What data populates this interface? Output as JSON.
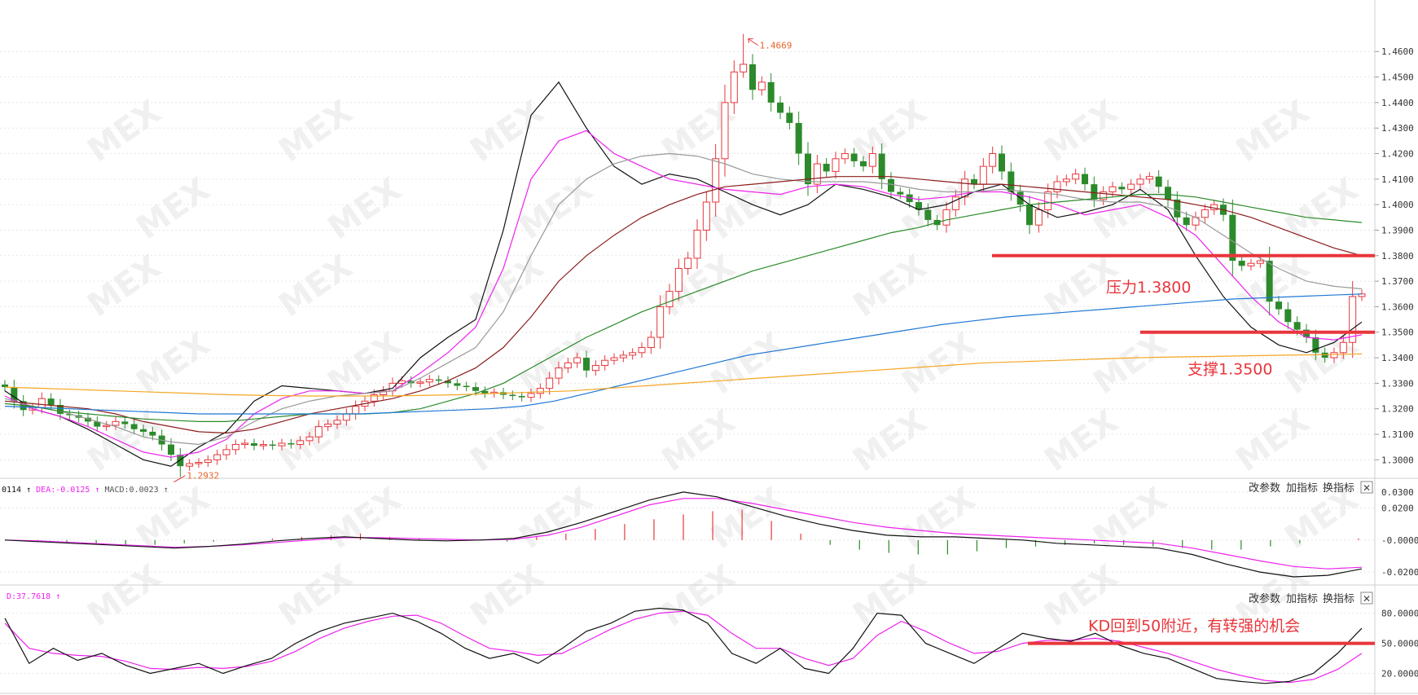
{
  "chart_data": {
    "type": "candlestick",
    "main": {
      "y_ticks": [
        "1.4600",
        "1.4500",
        "1.4400",
        "1.4300",
        "1.4200",
        "1.4100",
        "1.4000",
        "1.3900",
        "1.3800",
        "1.3700",
        "1.3600",
        "1.3500",
        "1.3400",
        "1.3300",
        "1.3200",
        "1.3100",
        "1.3000"
      ],
      "ylim": [
        1.295,
        1.477
      ],
      "high_label": "1.4669",
      "low_label": "1.2932",
      "closes": [
        1.3285,
        1.323,
        1.3195,
        1.3205,
        1.324,
        1.3215,
        1.318,
        1.3175,
        1.3165,
        1.315,
        1.313,
        1.3135,
        1.315,
        1.314,
        1.312,
        1.311,
        1.3095,
        1.306,
        1.302,
        1.2975,
        1.2985,
        1.299,
        1.3,
        1.302,
        1.304,
        1.306,
        1.3065,
        1.3055,
        1.306,
        1.3055,
        1.3065,
        1.306,
        1.3075,
        1.309,
        1.313,
        1.314,
        1.3155,
        1.318,
        1.321,
        1.323,
        1.3255,
        1.327,
        1.33,
        1.331,
        1.33,
        1.3305,
        1.3315,
        1.331,
        1.33,
        1.329,
        1.3285,
        1.327,
        1.326,
        1.3265,
        1.3255,
        1.325,
        1.3245,
        1.326,
        1.328,
        1.332,
        1.336,
        1.338,
        1.34,
        1.335,
        1.337,
        1.339,
        1.34,
        1.341,
        1.342,
        1.344,
        1.348,
        1.36,
        1.366,
        1.375,
        1.379,
        1.39,
        1.401,
        1.418,
        1.44,
        1.452,
        1.455,
        1.445,
        1.448,
        1.44,
        1.436,
        1.432,
        1.42,
        1.408,
        1.416,
        1.413,
        1.418,
        1.42,
        1.417,
        1.415,
        1.42,
        1.41,
        1.405,
        1.404,
        1.401,
        1.398,
        1.394,
        1.392,
        1.398,
        1.403,
        1.41,
        1.408,
        1.415,
        1.42,
        1.413,
        1.405,
        1.4,
        1.392,
        1.398,
        1.405,
        1.409,
        1.41,
        1.412,
        1.408,
        1.402,
        1.405,
        1.407,
        1.406,
        1.408,
        1.41,
        1.411,
        1.407,
        1.402,
        1.395,
        1.392,
        1.395,
        1.398,
        1.4,
        1.396,
        1.378,
        1.376,
        1.377,
        1.378,
        1.362,
        1.359,
        1.354,
        1.351,
        1.348,
        1.342,
        1.34,
        1.342,
        1.346,
        1.364,
        1.365
      ],
      "ma_series": [
        {
          "color": "#111111",
          "values": [
            1.327,
            1.32,
            1.317,
            1.312,
            1.306,
            1.3,
            1.2975,
            1.305,
            1.311,
            1.323,
            1.329,
            1.328,
            1.327,
            1.326,
            1.328,
            1.34,
            1.348,
            1.355,
            1.39,
            1.435,
            1.448,
            1.43,
            1.415,
            1.408,
            1.412,
            1.41,
            1.405,
            1.4,
            1.396,
            1.4,
            1.408,
            1.406,
            1.403,
            1.398,
            1.4,
            1.405,
            1.408,
            1.4,
            1.395,
            1.397,
            1.4,
            1.406,
            1.398,
            1.38,
            1.364,
            1.352,
            1.345,
            1.342,
            1.346,
            1.354
          ]
        },
        {
          "color": "#ee22ee",
          "values": [
            1.325,
            1.32,
            1.317,
            1.313,
            1.308,
            1.303,
            1.301,
            1.303,
            1.308,
            1.318,
            1.324,
            1.327,
            1.327,
            1.326,
            1.327,
            1.334,
            1.342,
            1.352,
            1.375,
            1.41,
            1.425,
            1.429,
            1.42,
            1.415,
            1.41,
            1.408,
            1.406,
            1.405,
            1.404,
            1.407,
            1.408,
            1.407,
            1.404,
            1.402,
            1.403,
            1.405,
            1.405,
            1.403,
            1.4,
            1.396,
            1.398,
            1.4,
            1.395,
            1.388,
            1.376,
            1.364,
            1.354,
            1.348,
            1.347,
            1.349
          ]
        },
        {
          "color": "#999999",
          "values": [
            1.324,
            1.321,
            1.319,
            1.316,
            1.313,
            1.309,
            1.307,
            1.306,
            1.309,
            1.315,
            1.32,
            1.323,
            1.325,
            1.326,
            1.327,
            1.332,
            1.338,
            1.344,
            1.358,
            1.38,
            1.4,
            1.41,
            1.416,
            1.419,
            1.42,
            1.419,
            1.416,
            1.412,
            1.41,
            1.409,
            1.409,
            1.409,
            1.408,
            1.406,
            1.405,
            1.405,
            1.406,
            1.405,
            1.404,
            1.402,
            1.401,
            1.401,
            1.399,
            1.395,
            1.388,
            1.381,
            1.375,
            1.37,
            1.368,
            1.367
          ]
        },
        {
          "color": "#8b1c1c",
          "values": [
            1.323,
            1.322,
            1.321,
            1.32,
            1.318,
            1.315,
            1.313,
            1.311,
            1.3105,
            1.312,
            1.315,
            1.318,
            1.32,
            1.322,
            1.324,
            1.327,
            1.331,
            1.336,
            1.344,
            1.356,
            1.37,
            1.38,
            1.388,
            1.395,
            1.4,
            1.404,
            1.407,
            1.408,
            1.409,
            1.41,
            1.411,
            1.411,
            1.411,
            1.41,
            1.409,
            1.408,
            1.408,
            1.407,
            1.406,
            1.405,
            1.404,
            1.403,
            1.402,
            1.4,
            1.398,
            1.395,
            1.391,
            1.387,
            1.383,
            1.38
          ]
        },
        {
          "color": "#2a8a2a",
          "values": [
            1.322,
            1.321,
            1.319,
            1.318,
            1.317,
            1.316,
            1.3155,
            1.315,
            1.315,
            1.316,
            1.317,
            1.318,
            1.318,
            1.318,
            1.3185,
            1.32,
            1.323,
            1.326,
            1.33,
            1.336,
            1.342,
            1.348,
            1.353,
            1.358,
            1.362,
            1.366,
            1.37,
            1.374,
            1.377,
            1.38,
            1.383,
            1.386,
            1.389,
            1.391,
            1.394,
            1.396,
            1.398,
            1.4,
            1.401,
            1.402,
            1.403,
            1.404,
            1.404,
            1.403,
            1.401,
            1.399,
            1.397,
            1.395,
            1.394,
            1.393
          ]
        },
        {
          "color": "#1f77d4",
          "values": [
            1.321,
            1.3205,
            1.32,
            1.3195,
            1.319,
            1.3185,
            1.318,
            1.318,
            1.318,
            1.318,
            1.318,
            1.318,
            1.3185,
            1.319,
            1.3195,
            1.32,
            1.321,
            1.323,
            1.326,
            1.329,
            1.332,
            1.335,
            1.338,
            1.341,
            1.343,
            1.345,
            1.347,
            1.349,
            1.351,
            1.353,
            1.3545,
            1.356,
            1.357,
            1.358,
            1.359,
            1.36,
            1.361,
            1.362,
            1.363,
            1.3635,
            1.364,
            1.3645,
            1.365
          ]
        },
        {
          "color": "#f5a623",
          "values": [
            1.3285,
            1.328,
            1.3275,
            1.327,
            1.3265,
            1.326,
            1.3255,
            1.3252,
            1.325,
            1.325,
            1.325,
            1.3252,
            1.3255,
            1.326,
            1.3265,
            1.327,
            1.328,
            1.329,
            1.33,
            1.331,
            1.332,
            1.333,
            1.334,
            1.335,
            1.336,
            1.337,
            1.338,
            1.3385,
            1.339,
            1.3395,
            1.34,
            1.3403,
            1.3405,
            1.3408,
            1.341,
            1.3412,
            1.3415
          ]
        }
      ]
    },
    "macd": {
      "legend": {
        "dif": "0114",
        "dea": "DEA:-0.0125",
        "macd": "MACD:0.0023"
      },
      "y_ticks": [
        "0.0300",
        "0.0200",
        "-0.0000",
        "-0.0200"
      ],
      "ylim": [
        -0.024,
        0.033
      ],
      "dif": [
        0.0,
        -0.001,
        -0.002,
        -0.003,
        -0.004,
        -0.005,
        -0.004,
        -0.0025,
        -0.0005,
        0.001,
        0.002,
        0.001,
        0.0,
        -0.0005,
        0.0,
        0.001,
        0.005,
        0.011,
        0.018,
        0.025,
        0.03,
        0.027,
        0.021,
        0.015,
        0.01,
        0.006,
        0.003,
        0.002,
        0.002,
        0.001,
        0.0,
        -0.002,
        -0.003,
        -0.004,
        -0.005,
        -0.009,
        -0.015,
        -0.02,
        -0.023,
        -0.022,
        -0.018
      ],
      "dea": [
        0.0,
        -0.0005,
        -0.0015,
        -0.0025,
        -0.0035,
        -0.0045,
        -0.004,
        -0.003,
        -0.0015,
        0.0,
        0.0015,
        0.0015,
        0.001,
        0.0005,
        0.0,
        0.0005,
        0.003,
        0.008,
        0.015,
        0.022,
        0.026,
        0.026,
        0.023,
        0.019,
        0.015,
        0.011,
        0.008,
        0.006,
        0.004,
        0.003,
        0.002,
        0.001,
        0.0,
        -0.001,
        -0.002,
        -0.005,
        -0.009,
        -0.013,
        -0.0165,
        -0.018,
        -0.017
      ],
      "hist": [
        0.0,
        -0.001,
        -0.001,
        -0.002,
        -0.003,
        -0.003,
        -0.002,
        -0.001,
        0.0,
        0.001,
        0.002,
        0.003,
        0.004,
        0.002,
        0.001,
        0.0,
        0.0,
        -0.001,
        0.002,
        0.004,
        0.007,
        0.01,
        0.013,
        0.016,
        0.018,
        0.019,
        0.012,
        0.004,
        -0.003,
        -0.006,
        -0.008,
        -0.009,
        -0.009,
        -0.007,
        -0.005,
        -0.004,
        -0.003,
        -0.002,
        -0.003,
        -0.004,
        -0.005,
        -0.006,
        -0.006,
        -0.004,
        -0.002,
        0.0,
        0.001
      ]
    },
    "kd": {
      "legend": {
        "d": "D:37.7618"
      },
      "y_ticks": [
        "80.0000",
        "50.0000",
        "20.0000"
      ],
      "ylim": [
        5,
        100
      ],
      "k": [
        75,
        30,
        45,
        33,
        40,
        28,
        20,
        25,
        30,
        20,
        28,
        35,
        50,
        62,
        70,
        75,
        80,
        72,
        60,
        45,
        35,
        40,
        30,
        45,
        62,
        70,
        82,
        85,
        83,
        70,
        40,
        30,
        45,
        25,
        20,
        45,
        80,
        78,
        50,
        40,
        30,
        45,
        60,
        55,
        52,
        60,
        48,
        40,
        35,
        25,
        15,
        12,
        10,
        12,
        20,
        40,
        65
      ],
      "d": [
        70,
        45,
        40,
        38,
        37,
        32,
        25,
        24,
        26,
        25,
        27,
        32,
        42,
        55,
        65,
        72,
        77,
        78,
        70,
        57,
        45,
        42,
        38,
        40,
        52,
        64,
        74,
        80,
        82,
        78,
        60,
        45,
        45,
        35,
        28,
        35,
        58,
        72,
        62,
        50,
        40,
        42,
        50,
        53,
        53,
        55,
        52,
        46,
        40,
        32,
        24,
        18,
        13,
        11,
        14,
        24,
        40
      ]
    },
    "lines": [
      {
        "label": "压力1.3800",
        "value": 1.38
      },
      {
        "label": "支撑1.3500",
        "value": 1.35
      },
      {
        "label": "KD回到50附近，有转强的机会",
        "value": 50
      }
    ],
    "buttons": [
      "改参数",
      "加指标",
      "换指标"
    ],
    "close_symbol": "✕",
    "watermark": "MEX"
  }
}
